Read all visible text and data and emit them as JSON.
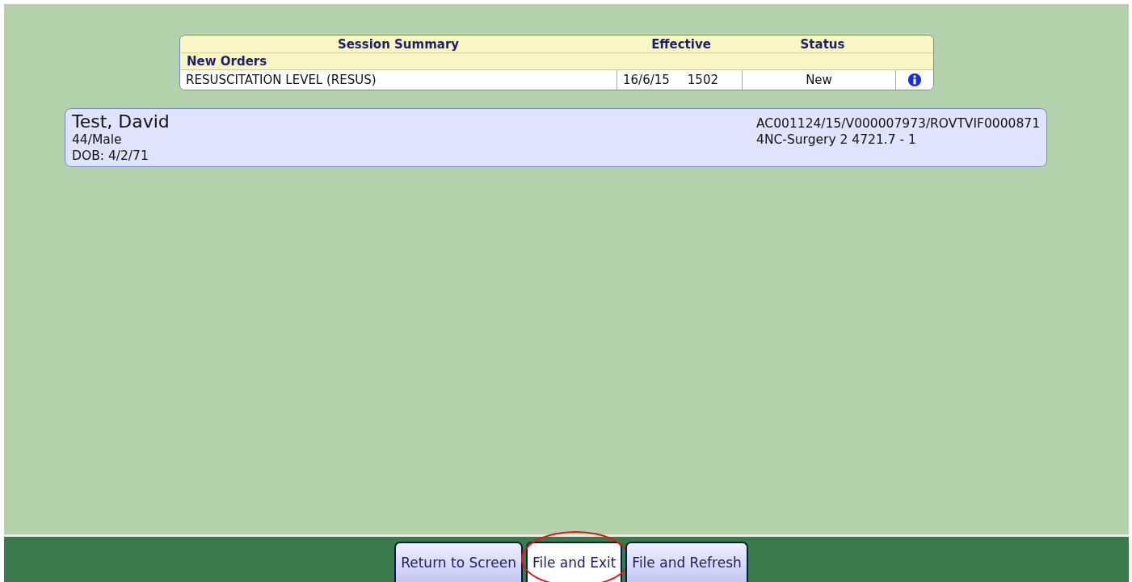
{
  "session_summary": {
    "columns": [
      "Session Summary",
      "Effective",
      "Status"
    ],
    "section": "New Orders",
    "rows": [
      {
        "order": "RESUSCITATION LEVEL (RESUS)",
        "date": "16/6/15",
        "time": "1502",
        "status": "New"
      }
    ]
  },
  "patient": {
    "name": "Test, David",
    "age_sex": "44/Male",
    "dob": "DOB: 4/2/71",
    "account": "AC001124/15/V000007973/ROVTVIF0000871",
    "location": "4NC-Surgery 2 4721.7 - 1"
  },
  "buttons": [
    {
      "label": "Return to Screen",
      "selected": false,
      "circled": false
    },
    {
      "label": "File and Exit",
      "selected": true,
      "circled": true
    },
    {
      "label": "File and Refresh",
      "selected": false,
      "circled": false
    }
  ]
}
